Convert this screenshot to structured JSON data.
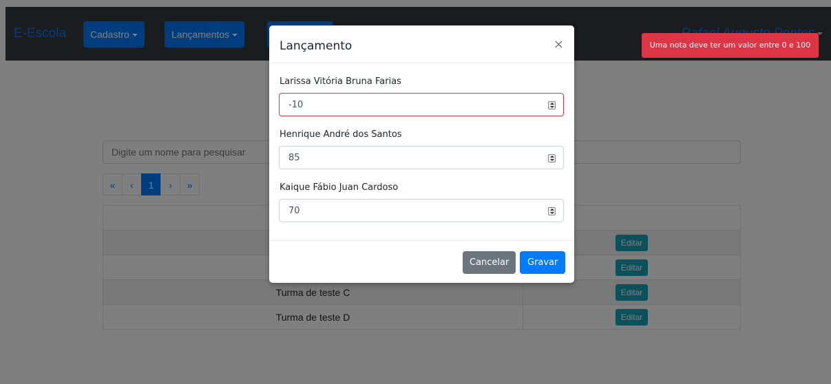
{
  "navbar": {
    "brand": "E-Escola",
    "menu_cadastro": "Cadastro",
    "menu_lancamentos": "Lançamentos",
    "user_name": "Rafael Augusto Pontes"
  },
  "search": {
    "placeholder": "Digite um nome para pesquisar"
  },
  "pagination": {
    "first": "«",
    "prev": "‹",
    "current": "1",
    "next": "›",
    "last": "»"
  },
  "table": {
    "rows": [
      {
        "name": "",
        "action": "Editar"
      },
      {
        "name": "",
        "action": "Editar"
      },
      {
        "name": "Turma de teste C",
        "action": "Editar"
      },
      {
        "name": "Turma de teste D",
        "action": "Editar"
      }
    ]
  },
  "modal": {
    "title": "Lançamento",
    "close": "×",
    "students": [
      {
        "name": "Larissa Vitória Bruna Farias",
        "grade": "-10"
      },
      {
        "name": "Henrique André dos Santos",
        "grade": "85"
      },
      {
        "name": "Kaique Fábio Juan Cardoso",
        "grade": "70"
      }
    ],
    "cancel_label": "Cancelar",
    "save_label": "Gravar"
  },
  "alert": {
    "message": "Uma nota deve ter um valor entre 0 e 100"
  },
  "colors": {
    "primary": "#007bff",
    "danger": "#dc3545",
    "info": "#17a2b8",
    "navbar": "#343a40"
  }
}
